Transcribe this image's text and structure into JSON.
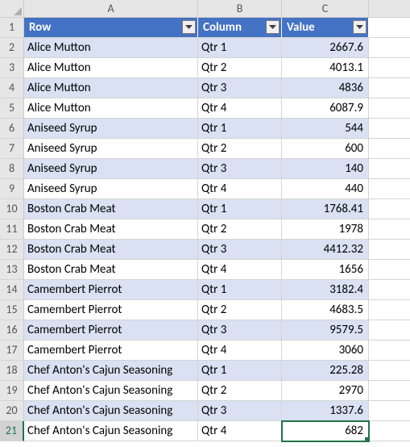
{
  "columns": {
    "A": "A",
    "B": "B",
    "C": "C"
  },
  "headers": {
    "row": "Row",
    "column": "Column",
    "value": "Value"
  },
  "rows": [
    {
      "n": 2,
      "row": "Alice Mutton",
      "col": "Qtr 1",
      "val": "2667.6"
    },
    {
      "n": 3,
      "row": "Alice Mutton",
      "col": "Qtr 2",
      "val": "4013.1"
    },
    {
      "n": 4,
      "row": "Alice Mutton",
      "col": "Qtr 3",
      "val": "4836"
    },
    {
      "n": 5,
      "row": "Alice Mutton",
      "col": "Qtr 4",
      "val": "6087.9"
    },
    {
      "n": 6,
      "row": "Aniseed Syrup",
      "col": "Qtr 1",
      "val": "544"
    },
    {
      "n": 7,
      "row": "Aniseed Syrup",
      "col": "Qtr 2",
      "val": "600"
    },
    {
      "n": 8,
      "row": "Aniseed Syrup",
      "col": "Qtr 3",
      "val": "140"
    },
    {
      "n": 9,
      "row": "Aniseed Syrup",
      "col": "Qtr 4",
      "val": "440"
    },
    {
      "n": 10,
      "row": "Boston Crab Meat",
      "col": "Qtr 1",
      "val": "1768.41"
    },
    {
      "n": 11,
      "row": "Boston Crab Meat",
      "col": "Qtr 2",
      "val": "1978"
    },
    {
      "n": 12,
      "row": "Boston Crab Meat",
      "col": "Qtr 3",
      "val": "4412.32"
    },
    {
      "n": 13,
      "row": "Boston Crab Meat",
      "col": "Qtr 4",
      "val": "1656"
    },
    {
      "n": 14,
      "row": "Camembert Pierrot",
      "col": "Qtr 1",
      "val": "3182.4"
    },
    {
      "n": 15,
      "row": "Camembert Pierrot",
      "col": "Qtr 2",
      "val": "4683.5"
    },
    {
      "n": 16,
      "row": "Camembert Pierrot",
      "col": "Qtr 3",
      "val": "9579.5"
    },
    {
      "n": 17,
      "row": "Camembert Pierrot",
      "col": "Qtr 4",
      "val": "3060"
    },
    {
      "n": 18,
      "row": "Chef Anton's Cajun Seasoning",
      "col": "Qtr 1",
      "val": "225.28"
    },
    {
      "n": 19,
      "row": "Chef Anton's Cajun Seasoning",
      "col": "Qtr 2",
      "val": "2970"
    },
    {
      "n": 20,
      "row": "Chef Anton's Cajun Seasoning",
      "col": "Qtr 3",
      "val": "1337.6"
    },
    {
      "n": 21,
      "row": "Chef Anton's Cajun Seasoning",
      "col": "Qtr 4",
      "val": "682"
    }
  ],
  "chart_data": {
    "type": "table",
    "title": "",
    "columns": [
      "Row",
      "Column",
      "Value"
    ],
    "data": [
      [
        "Alice Mutton",
        "Qtr 1",
        2667.6
      ],
      [
        "Alice Mutton",
        "Qtr 2",
        4013.1
      ],
      [
        "Alice Mutton",
        "Qtr 3",
        4836
      ],
      [
        "Alice Mutton",
        "Qtr 4",
        6087.9
      ],
      [
        "Aniseed Syrup",
        "Qtr 1",
        544
      ],
      [
        "Aniseed Syrup",
        "Qtr 2",
        600
      ],
      [
        "Aniseed Syrup",
        "Qtr 3",
        140
      ],
      [
        "Aniseed Syrup",
        "Qtr 4",
        440
      ],
      [
        "Boston Crab Meat",
        "Qtr 1",
        1768.41
      ],
      [
        "Boston Crab Meat",
        "Qtr 2",
        1978
      ],
      [
        "Boston Crab Meat",
        "Qtr 3",
        4412.32
      ],
      [
        "Boston Crab Meat",
        "Qtr 4",
        1656
      ],
      [
        "Camembert Pierrot",
        "Qtr 1",
        3182.4
      ],
      [
        "Camembert Pierrot",
        "Qtr 2",
        4683.5
      ],
      [
        "Camembert Pierrot",
        "Qtr 3",
        9579.5
      ],
      [
        "Camembert Pierrot",
        "Qtr 4",
        3060
      ],
      [
        "Chef Anton's Cajun Seasoning",
        "Qtr 1",
        225.28
      ],
      [
        "Chef Anton's Cajun Seasoning",
        "Qtr 2",
        2970
      ],
      [
        "Chef Anton's Cajun Seasoning",
        "Qtr 3",
        1337.6
      ],
      [
        "Chef Anton's Cajun Seasoning",
        "Qtr 4",
        682
      ]
    ]
  }
}
